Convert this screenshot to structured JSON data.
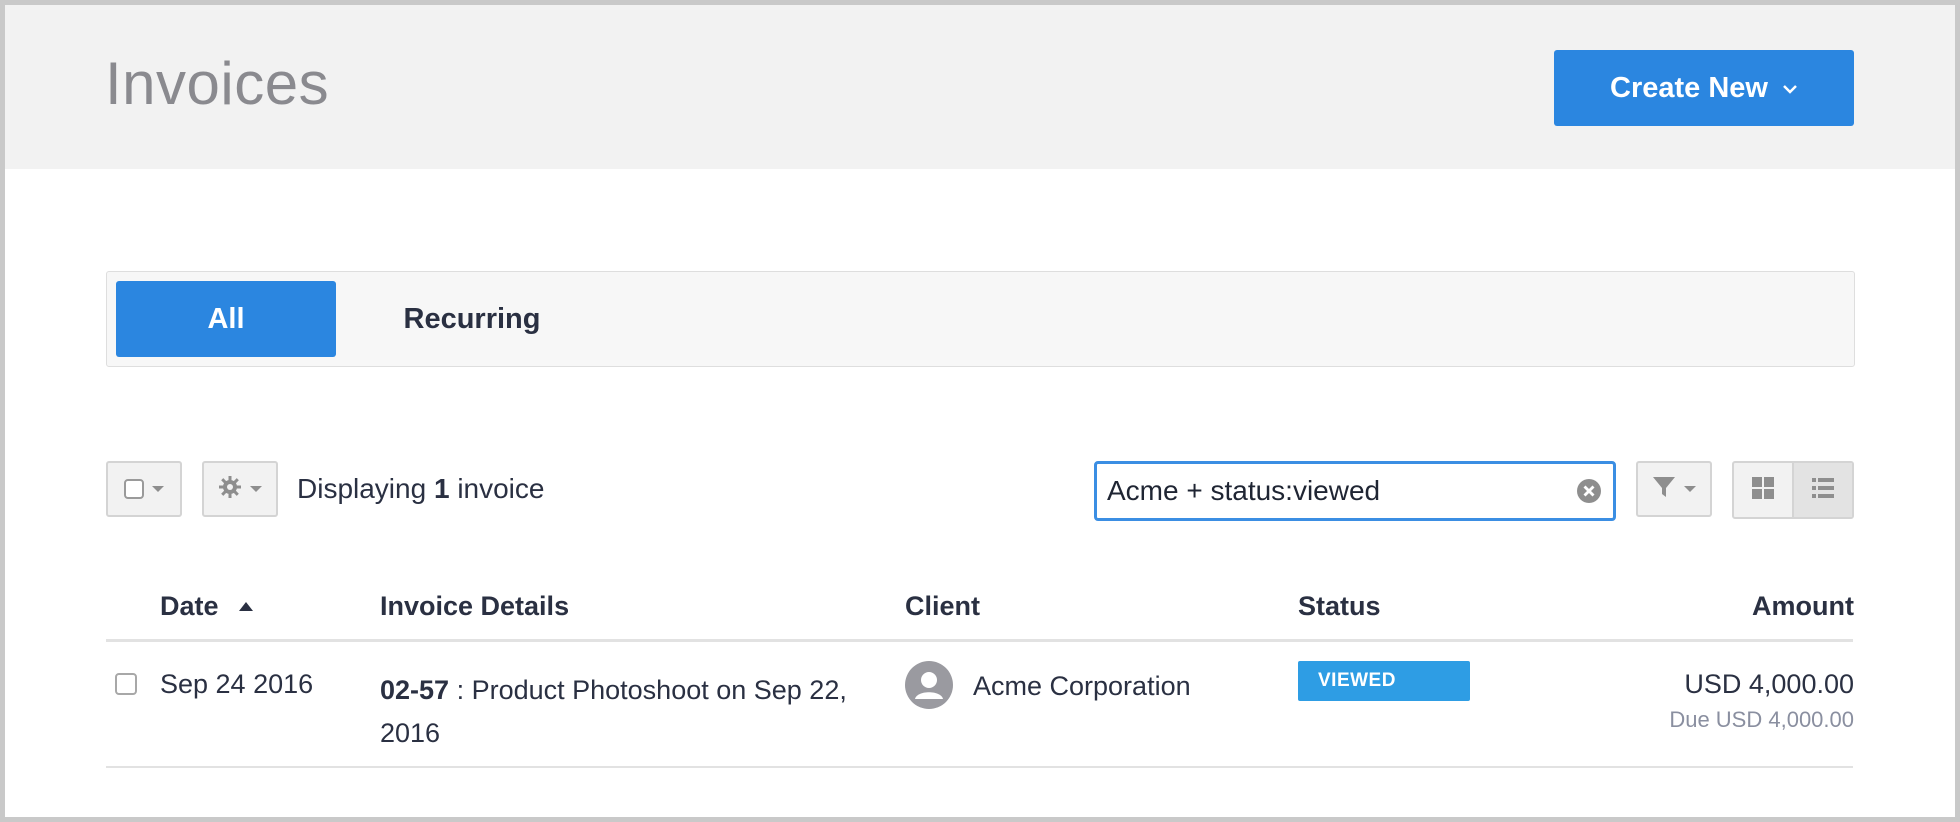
{
  "header": {
    "title": "Invoices",
    "create_button_label": "Create New"
  },
  "tabs": [
    {
      "label": "All",
      "active": true
    },
    {
      "label": "Recurring",
      "active": false
    }
  ],
  "toolbar": {
    "displaying_prefix": "Displaying",
    "displaying_count": "1",
    "displaying_suffix": "invoice",
    "search_value": "Acme + status:viewed"
  },
  "table": {
    "columns": {
      "date": "Date",
      "details": "Invoice Details",
      "client": "Client",
      "status": "Status",
      "amount": "Amount"
    },
    "rows": [
      {
        "date": "Sep 24 2016",
        "invoice_number": "02-57",
        "description": " : Product Photoshoot on Sep 22, 2016",
        "client": "Acme Corporation",
        "status": "VIEWED",
        "amount": "USD 4,000.00",
        "due": "Due USD 4,000.00"
      }
    ]
  },
  "colors": {
    "accent": "#2b86e0",
    "status_viewed": "#2e9de4",
    "header_bg": "#f2f2f2"
  },
  "icons": [
    "chevron-down-icon",
    "checkbox-icon",
    "gear-icon",
    "clear-search-icon",
    "filter-icon",
    "grid-view-icon",
    "list-view-icon",
    "sort-ascending-icon",
    "avatar-icon"
  ]
}
